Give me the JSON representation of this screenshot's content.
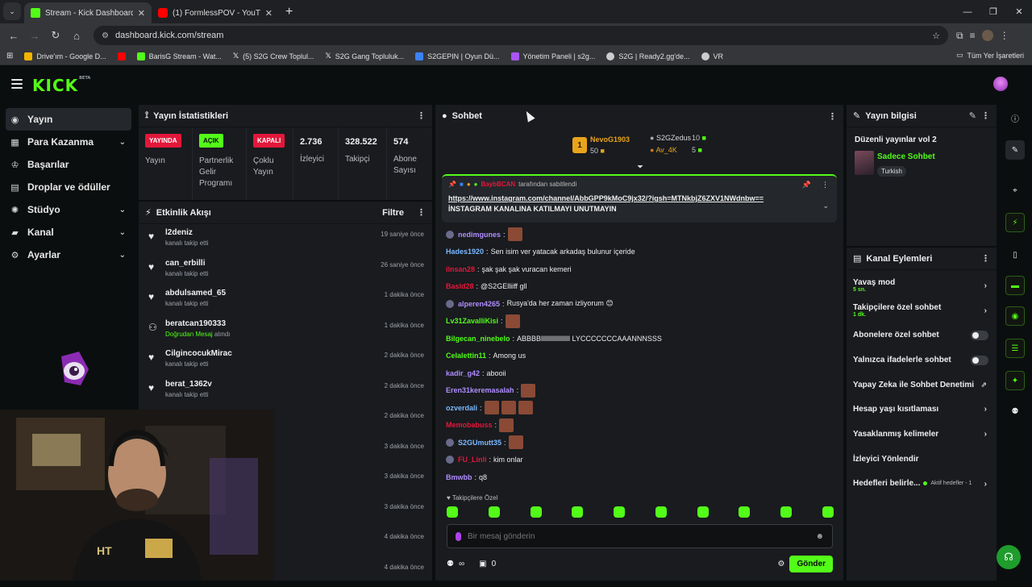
{
  "browser": {
    "tabs": [
      {
        "title": "Stream - Kick Dashboard",
        "color": "#53fc18",
        "active": true
      },
      {
        "title": "(1) FormlessPOV - YouTube",
        "color": "#ff0000",
        "active": false
      }
    ],
    "url": "dashboard.kick.com/stream",
    "bookmarks": [
      {
        "label": "Drive'ım - Google D...",
        "color": "#f4b400"
      },
      {
        "label": "BarisG Stream - Wat...",
        "color": "#53fc18"
      },
      {
        "label": "(5) S2G Crew Toplul...",
        "color": "#ffffff"
      },
      {
        "label": "S2G Gang Topluluk...",
        "color": "#ffffff"
      },
      {
        "label": "S2GEPIN | Oyun Dü...",
        "color": "#3b82f6"
      },
      {
        "label": "Yönetim Paneli | s2g...",
        "color": "#a855f7"
      },
      {
        "label": "S2G | Ready2.gg'de...",
        "color": "#cccccc"
      },
      {
        "label": "VR",
        "color": "#cccccc"
      }
    ],
    "all_bookmarks": "Tüm Yer İşaretleri"
  },
  "logo": {
    "text": "KICK",
    "sup": "BETA"
  },
  "sidebar": {
    "items": [
      {
        "label": "Yayın",
        "icon": "broadcast-icon",
        "active": true
      },
      {
        "label": "Para Kazanma",
        "icon": "money-icon",
        "chev": true
      },
      {
        "label": "Başarılar",
        "icon": "trophy-icon"
      },
      {
        "label": "Droplar ve ödüller",
        "icon": "gift-icon"
      },
      {
        "label": "Stüdyo",
        "icon": "studio-icon",
        "chev": true
      },
      {
        "label": "Kanal",
        "icon": "channel-icon",
        "chev": true
      },
      {
        "label": "Ayarlar",
        "icon": "gear-icon",
        "chev": true
      }
    ]
  },
  "stats": {
    "title": "Yayın İstatistikleri",
    "cells": [
      {
        "badge": "YAYINDA",
        "label": "Yayın",
        "badge_color": "red"
      },
      {
        "badge": "AÇIK",
        "label": "Partnerlik Gelir Programı",
        "badge_color": "green"
      },
      {
        "badge": "KAPALI",
        "label": "Çoklu Yayın",
        "badge_color": "red"
      },
      {
        "num": "2.736",
        "label": "İzleyici"
      },
      {
        "num": "328.522",
        "label": "Takipçi"
      },
      {
        "num": "574",
        "label": "Abone Sayısı"
      }
    ]
  },
  "activity": {
    "title": "Etkinlik Akışı",
    "filter": "Filtre",
    "rows": [
      {
        "user": "l2deniz",
        "action": "kanalı takip etti",
        "time": "19 saniye önce",
        "icon": "heart-icon"
      },
      {
        "user": "can_erbilli",
        "action": "kanalı takip etti",
        "time": "26 saniye önce",
        "icon": "heart-icon"
      },
      {
        "user": "abdulsamed_65",
        "action": "kanalı takip etti",
        "time": "1 dakika önce",
        "icon": "heart-icon"
      },
      {
        "user": "beratcan190333",
        "action_hl": "Doğrudan Mesaj",
        "action": " alındı",
        "time": "1 dakika önce",
        "icon": "dm-icon"
      },
      {
        "user": "CilgincocukMirac",
        "action": "kanalı takip etti",
        "time": "2 dakika önce",
        "icon": "heart-icon"
      },
      {
        "user": "berat_1362v",
        "action": "kanalı takip etti",
        "time": "2 dakika önce",
        "icon": "heart-icon"
      },
      {
        "user": "",
        "action": "",
        "time": "2 dakika önce"
      },
      {
        "user": "",
        "action": "",
        "time": "3 dakika önce"
      },
      {
        "user": "",
        "action": "",
        "time": "3 dakika önce"
      },
      {
        "user": "",
        "action": "",
        "time": "3 dakika önce"
      },
      {
        "user": "",
        "action": "",
        "time": "4 dakika önce"
      },
      {
        "user": "",
        "action": "",
        "time": "4 dakika önce"
      }
    ]
  },
  "chat": {
    "title": "Sohbet",
    "leaders": {
      "first_name": "NevoG1903",
      "first_val": "50",
      "second_name": "S2GZedus",
      "second_val": "10",
      "third_name": "Av_4K",
      "third_val": "5"
    },
    "pinned": {
      "by": "tarafından sabitlendi",
      "user": "BaybBCAN",
      "link": "https://www.instagram.com/channel/AbbGPP9kMoC9jx32/?igsh=MTNkbjZ6ZXV1NWdnbw==",
      "text": "İNSTAGRAM KANALINA KATILMAYI UNUTMAYIN"
    },
    "messages": [
      {
        "user": "nedimgunes",
        "color": "#b08cff",
        "text": "",
        "emote": true,
        "badge": true
      },
      {
        "user": "Hades1920",
        "color": "#7ab8ff",
        "text": "Sen isim ver yatacak arkadaş bulunur içeride"
      },
      {
        "user": "ilnsan28",
        "color": "#e3173a",
        "text": "şak şak şak vuracan kemeri"
      },
      {
        "user": "Basld28",
        "color": "#e3173a",
        "text": "@S2GElliiff gll"
      },
      {
        "user": "alperen4265",
        "color": "#b08cff",
        "text": "Rusya'da her zaman izliyorum 😊",
        "badge": true
      },
      {
        "user": "Lv31ZavalliKisi",
        "color": "#53fc18",
        "text": "",
        "emote": true
      },
      {
        "user": "Bilgecan_ninebelo",
        "color": "#53fc18",
        "text": "ABBBBllllllllllllllllll LYCCCCCCCAAANNNSSS"
      },
      {
        "user": "Celalettin11",
        "color": "#53fc18",
        "text": "Among us"
      },
      {
        "user": "kadir_g42",
        "color": "#b08cff",
        "text": "abooii"
      },
      {
        "user": "Eren31keremasalah",
        "color": "#b08cff",
        "text": "",
        "emote": true
      },
      {
        "user": "ozverdali",
        "color": "#7ab8ff",
        "text": "",
        "emote": true,
        "emotes": 3
      },
      {
        "user": "Memobabuss",
        "color": "#e3173a",
        "text": "",
        "emote": true
      },
      {
        "user": "S2GUmutt35",
        "color": "#7ab8ff",
        "text": "",
        "emote": true,
        "badge": true
      },
      {
        "user": "FU_Linli",
        "color": "#e3173a",
        "text": "kim onlar",
        "badge": true
      },
      {
        "user": "Bmwbb",
        "color": "#b08cff",
        "text": "q8"
      }
    ],
    "followers_only": "Takipçilere Özel",
    "input_placeholder": "Bir mesaj gönderin",
    "infinity": "∞",
    "points": "0",
    "send": "Gönder"
  },
  "info": {
    "title": "Yayın bilgisi",
    "stream_title": "Düzenli yayınlar vol 2",
    "category": "Sadece Sohbet",
    "language": "Turkish"
  },
  "actions": {
    "title": "Kanal Eylemleri",
    "items": [
      {
        "label": "Yavaş mod",
        "sub": "5 sn.",
        "kind": "chev"
      },
      {
        "label": "Takipçilere özel sohbet",
        "sub": "1 dk.",
        "kind": "chev"
      },
      {
        "label": "Abonelere özel sohbet",
        "kind": "toggle"
      },
      {
        "label": "Yalnızca ifadelerle sohbet",
        "kind": "toggle"
      },
      {
        "label": "Yapay Zeka ile Sohbet Denetimi",
        "kind": "ext"
      },
      {
        "label": "Hesap yaşı kısıtlaması",
        "kind": "chev"
      },
      {
        "label": "Yasaklanmış kelimeler",
        "kind": "chev"
      },
      {
        "label": "İzleyici Yönlendir",
        "kind": "none"
      },
      {
        "label": "Hedefleri belirle...",
        "kind": "goal",
        "goal": "Aktif hedefler - 1"
      }
    ]
  }
}
